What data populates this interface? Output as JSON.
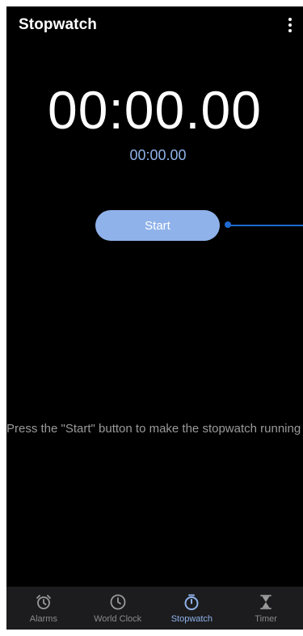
{
  "header": {
    "title": "Stopwatch"
  },
  "stopwatch": {
    "main_time": "00:00.00",
    "lap_time": "00:00.00",
    "start_label": "Start",
    "hint": "Press the \"Start\" button to make the stopwatch running"
  },
  "nav": {
    "items": [
      {
        "label": "Alarms",
        "icon": "alarm-icon"
      },
      {
        "label": "World Clock",
        "icon": "clock-icon"
      },
      {
        "label": "Stopwatch",
        "icon": "stopwatch-icon",
        "active": true
      },
      {
        "label": "Timer",
        "icon": "hourglass-icon"
      }
    ]
  },
  "colors": {
    "background": "#000000",
    "accent": "#8fb2ea",
    "tip_line": "#1e6ad0",
    "nav_background": "#1c1c1e"
  }
}
